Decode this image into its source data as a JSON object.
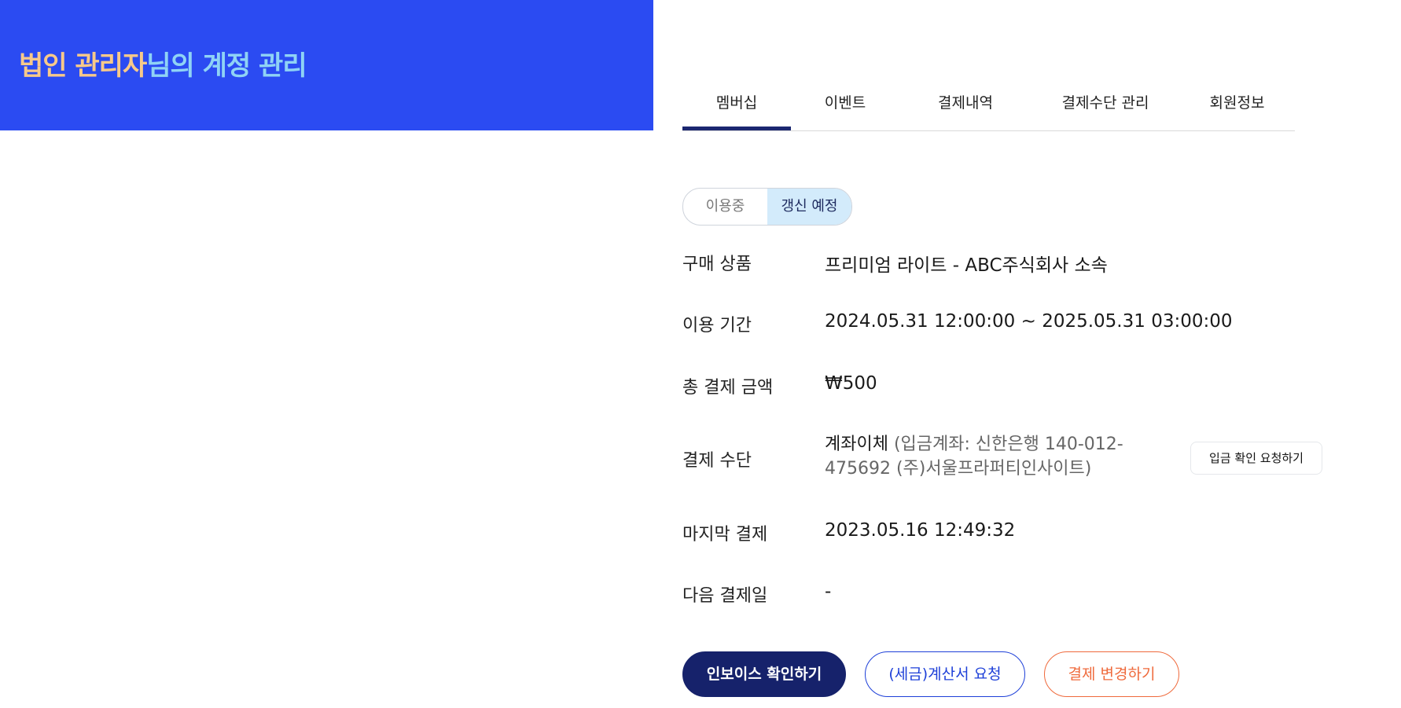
{
  "header": {
    "title_highlight": "법인 관리자",
    "title_rest": "님의 계정 관리",
    "colors": {
      "background": "#2b4bf2",
      "highlight": "#f7c98a",
      "rest": "#8fd3f5"
    }
  },
  "tabs": [
    {
      "label": "멤버십",
      "active": true
    },
    {
      "label": "이벤트",
      "active": false
    },
    {
      "label": "결제내역",
      "active": false
    },
    {
      "label": "결제수단 관리",
      "active": false
    },
    {
      "label": "회원정보",
      "active": false
    }
  ],
  "segment": {
    "options": [
      "이용중",
      "갱신 예정"
    ],
    "selected": "갱신 예정"
  },
  "details": {
    "product": {
      "label": "구매 상품",
      "value": "프리미엄 라이트 - ABC주식회사 소속"
    },
    "period": {
      "label": "이용 기간",
      "value": "2024.05.31 12:00:00 ~ 2025.05.31 03:00:00"
    },
    "amount": {
      "label": "총 결제 금액",
      "value": "₩500"
    },
    "method": {
      "label": "결제 수단",
      "value_main": "계좌이체",
      "value_detail": " (입금계좌: 신한은행 140-012-475692 (주)서울프라퍼티인사이트)",
      "action_label": "입금 확인 요청하기"
    },
    "last_payment": {
      "label": "마지막 결제",
      "value": "2023.05.16 12:49:32"
    },
    "next_payment": {
      "label": "다음 결제일",
      "value": "-"
    }
  },
  "actions": {
    "invoice": "인보이스 확인하기",
    "tax": "(세금)계산서 요청",
    "change": "결제 변경하기"
  },
  "colors": {
    "accent_dark": "#16226b",
    "accent_blue": "#1d3fd8",
    "accent_orange": "#ef6a3c",
    "segment_selected": "#d3ebfb"
  }
}
